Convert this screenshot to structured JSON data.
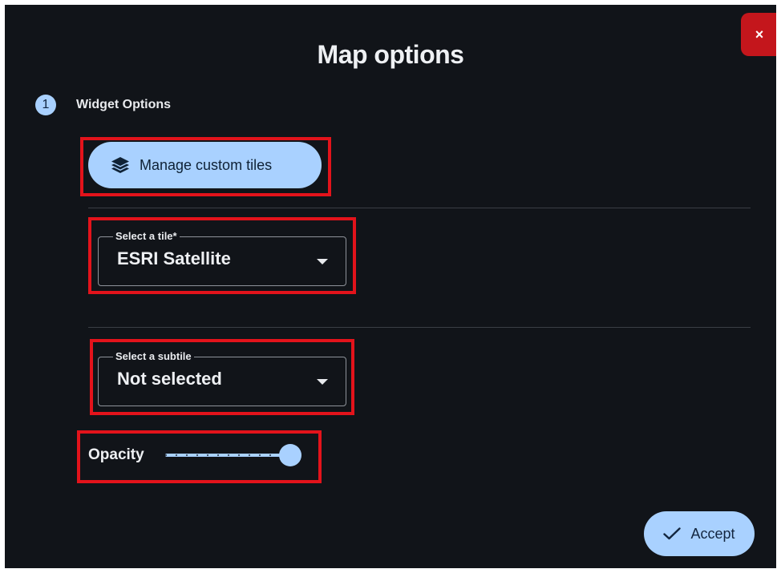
{
  "dialog": {
    "title": "Map options",
    "close_label": "×"
  },
  "step": {
    "number": "1",
    "label": "Widget Options"
  },
  "manage_button": {
    "label": "Manage custom tiles",
    "icon": "layers-icon"
  },
  "tile_select": {
    "legend": "Select a tile*",
    "value": "ESRI Satellite"
  },
  "subtile_select": {
    "legend": "Select a subtile",
    "value": "Not selected"
  },
  "opacity": {
    "label": "Opacity",
    "value": 1.0
  },
  "accept_button": {
    "label": "Accept",
    "icon": "check-icon"
  },
  "colors": {
    "background": "#111419",
    "accent": "#a9d1ff",
    "close": "#c4161c",
    "highlight": "#e3131b"
  }
}
